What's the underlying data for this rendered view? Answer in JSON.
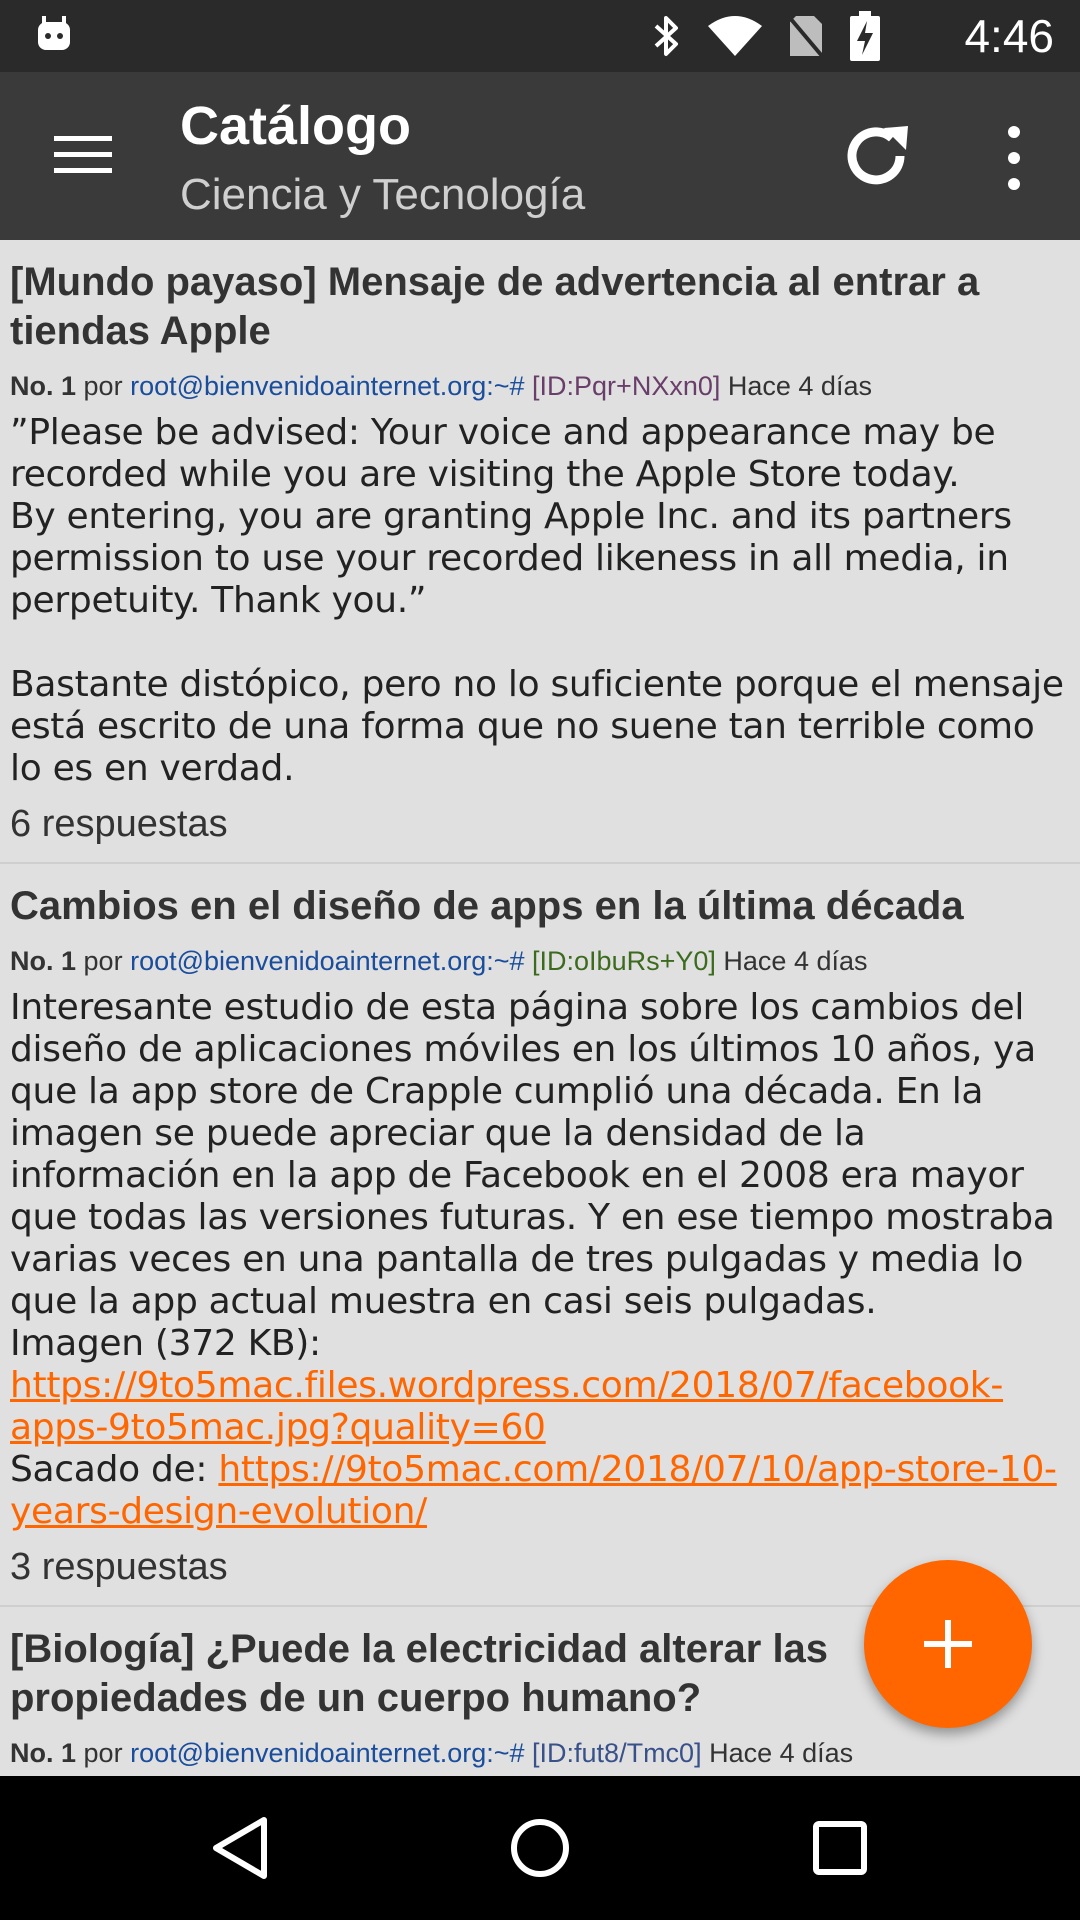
{
  "status_bar": {
    "time": "4:46",
    "icons": [
      "android-debug-icon",
      "bluetooth-icon",
      "wifi-icon",
      "no-sim-icon",
      "battery-charging-icon"
    ]
  },
  "toolbar": {
    "title": "Catálogo",
    "subtitle": "Ciencia y Tecnología",
    "icons": [
      "menu-icon",
      "refresh-icon",
      "more-vert-icon"
    ]
  },
  "threads": [
    {
      "title": "[Mundo payaso] Mensaje de advertencia al entrar a tiendas Apple",
      "no_label": "No. 1",
      "por": "por",
      "author": "root@bienvenidoainternet.org:~#",
      "id": "[ID:Pqr+NXxn0]",
      "time": "Hace 4 días",
      "body": "”Please be advised: Your voice and appearance may be recorded while you are visiting the Apple Store today.\nBy entering, you are granting Apple Inc. and its partners permission to use your recorded likeness in all media, in perpetuity. Thank you.”\n\nBastante distópico, pero no lo suficiente porque el mensaje está escrito de una forma que no suene tan terrible como lo es en verdad.",
      "replies": "6 respuestas"
    },
    {
      "title": "Cambios en el diseño de apps en la última década",
      "no_label": "No. 1",
      "por": "por",
      "author": "root@bienvenidoainternet.org:~#",
      "id": "[ID:oIbuRs+Y0]",
      "time": "Hace 4 días",
      "body": "Interesante estudio de esta página sobre los cambios del diseño de aplicaciones móviles en los últimos 10 años, ya que la app store de Crapple cumplió una década. En la imagen se puede apreciar que la densidad de la información en la app de Facebook en el 2008 era mayor que todas las versiones futuras. Y en ese tiempo mostraba varias veces en una pantalla de tres pulgadas y media lo que la app actual muestra en casi seis pulgadas.\n",
      "image_label": "Imagen (372 KB): ",
      "image_link": "https://9to5mac.files.wordpress.com/2018/07/facebook-apps-9to5mac.jpg?quality=60",
      "source_label": "Sacado de: ",
      "source_link": "https://9to5mac.com/2018/07/10/app-store-10-years-design-evolution/",
      "replies": "3 respuestas"
    },
    {
      "title": "[Biología] ¿Puede la electricidad alterar las propiedades de un cuerpo humano?",
      "no_label": "No. 1",
      "por": "por",
      "author": "root@bienvenidoainternet.org:~#",
      "id": "[ID:fut8/Tmc0]",
      "time": "Hace 4 días"
    }
  ],
  "fab": {
    "icon": "add-icon"
  },
  "nav_bar": {
    "icons": [
      "back-icon",
      "home-icon",
      "recents-icon"
    ]
  }
}
